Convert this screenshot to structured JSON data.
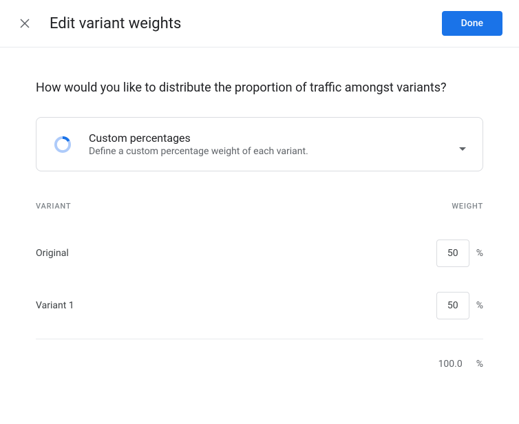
{
  "header": {
    "title": "Edit variant weights",
    "done_label": "Done"
  },
  "question": "How would you like to distribute the proportion of traffic amongst variants?",
  "selector": {
    "title": "Custom percentages",
    "description": "Define a custom percentage weight of each variant."
  },
  "table": {
    "col_variant": "Variant",
    "col_weight": "Weight"
  },
  "rows": [
    {
      "label": "Original",
      "value": "50"
    },
    {
      "label": "Variant 1",
      "value": "50"
    }
  ],
  "percent_symbol": "%",
  "total": "100.0"
}
